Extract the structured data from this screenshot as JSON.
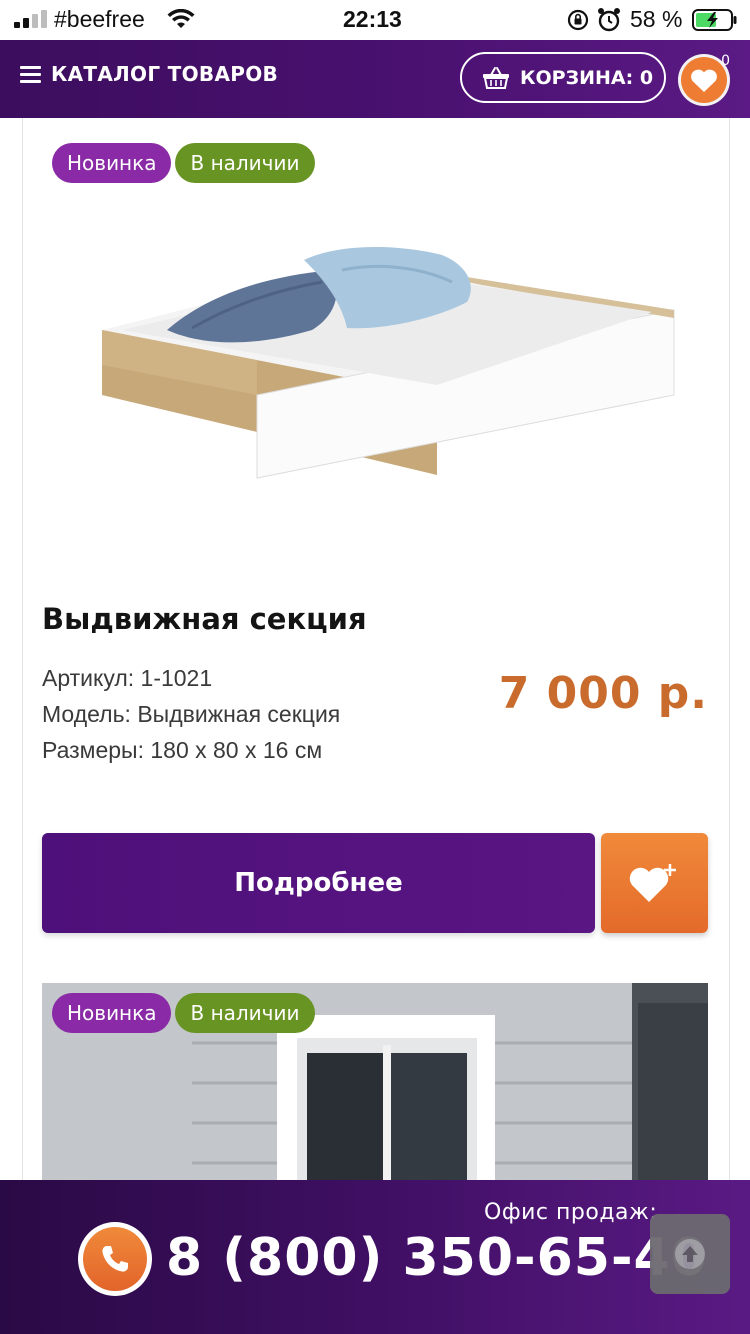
{
  "status_bar": {
    "carrier": "#beefree",
    "time": "22:13",
    "battery_percent": "58 %"
  },
  "header": {
    "catalog_label": "КАТАЛОГ ТОВАРОВ",
    "cart_label": "КОРЗИНА: 0",
    "favorites_count": "0"
  },
  "products": [
    {
      "badge_new": "Новинка",
      "badge_stock": "В наличии",
      "title": "Выдвижная секция",
      "sku": "Артикул: 1-1021",
      "model": "Модель: Выдвижная секция",
      "dimensions": "Размеры: 180 х 80 х 16 см",
      "price": "7 000 р.",
      "details_label": "Подробнее"
    },
    {
      "badge_new": "Новинка",
      "badge_stock": "В наличии"
    }
  ],
  "footer": {
    "office_label": "Офис продаж:",
    "phone": "8 (800) 350-65-40"
  },
  "colors": {
    "brand_purple": "#4e107a",
    "accent_orange": "#ee7d33",
    "badge_new": "#8a2aa6",
    "badge_stock": "#689423",
    "price": "#c96b2d"
  }
}
